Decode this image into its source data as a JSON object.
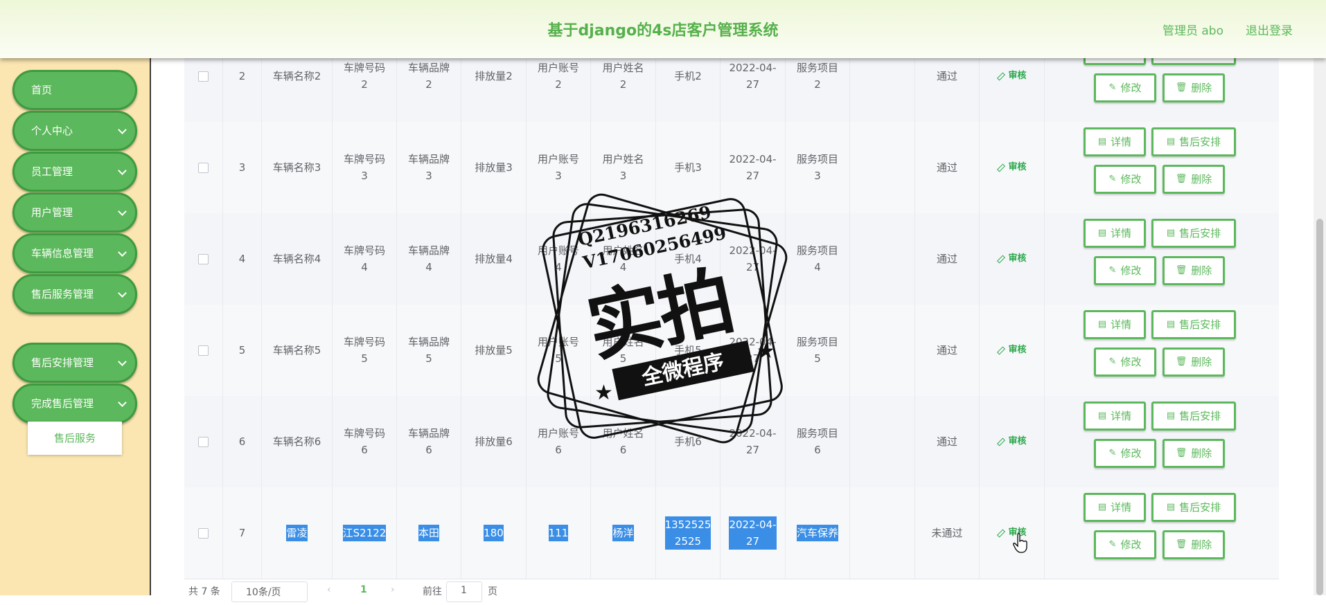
{
  "header": {
    "title": "基于django的4s店客户管理系统",
    "user_label": "管理员 abo",
    "logout_label": "退出登录"
  },
  "sidebar": {
    "items": [
      {
        "label": "首页",
        "has_arrow": false
      },
      {
        "label": "个人中心",
        "has_arrow": true
      },
      {
        "label": "员工管理",
        "has_arrow": true
      },
      {
        "label": "用户管理",
        "has_arrow": true
      },
      {
        "label": "车辆信息管理",
        "has_arrow": true
      },
      {
        "label": "售后服务管理",
        "has_arrow": true
      },
      {
        "label": "售后安排管理",
        "has_arrow": true
      },
      {
        "label": "完成售后管理",
        "has_arrow": true
      }
    ],
    "submenu_label": "售后服务"
  },
  "table": {
    "audit_label": "审核",
    "actions": {
      "detail": "详情",
      "arrange": "售后安排",
      "edit": "修改",
      "delete": "删除"
    },
    "rows": [
      {
        "id": "2",
        "car_name": "车辆名称2",
        "plate": "车牌号码\n2",
        "brand": "车辆品牌\n2",
        "displacement": "排放量2",
        "account": "用户账号\n2",
        "username": "用户姓名\n2",
        "phone": "手机2",
        "date": "2022-04-\n27",
        "service": "服务项目\n2",
        "status": "通过",
        "selected": false,
        "partial": true
      },
      {
        "id": "3",
        "car_name": "车辆名称3",
        "plate": "车牌号码\n3",
        "brand": "车辆品牌\n3",
        "displacement": "排放量3",
        "account": "用户账号\n3",
        "username": "用户姓名\n3",
        "phone": "手机3",
        "date": "2022-04-\n27",
        "service": "服务项目\n3",
        "status": "通过",
        "selected": false,
        "partial": false
      },
      {
        "id": "4",
        "car_name": "车辆名称4",
        "plate": "车牌号码\n4",
        "brand": "车辆品牌\n4",
        "displacement": "排放量4",
        "account": "用户账号\n4",
        "username": "用户姓名\n4",
        "phone": "手机4",
        "date": "2022-04-\n27",
        "service": "服务项目\n4",
        "status": "通过",
        "selected": false,
        "partial": false
      },
      {
        "id": "5",
        "car_name": "车辆名称5",
        "plate": "车牌号码\n5",
        "brand": "车辆品牌\n5",
        "displacement": "排放量5",
        "account": "用户账号\n5",
        "username": "用户姓名\n5",
        "phone": "手机5",
        "date": "2022-04-\n27",
        "service": "服务项目\n5",
        "status": "通过",
        "selected": false,
        "partial": false
      },
      {
        "id": "6",
        "car_name": "车辆名称6",
        "plate": "车牌号码\n6",
        "brand": "车辆品牌\n6",
        "displacement": "排放量6",
        "account": "用户账号\n6",
        "username": "用户姓名\n6",
        "phone": "手机6",
        "date": "2022-04-\n27",
        "service": "服务项目\n6",
        "status": "通过",
        "selected": false,
        "partial": false
      },
      {
        "id": "7",
        "car_name": "雷凌",
        "plate": "江S2122",
        "brand": "本田",
        "displacement": "180",
        "account": "111",
        "username": "杨洋",
        "phone": "1352525\n2525",
        "date": "2022-04-\n27",
        "service": "汽车保养",
        "status": "未通过",
        "selected": true,
        "partial": false
      }
    ]
  },
  "pagination": {
    "total": "共 7 条",
    "page_size": "10条/页",
    "current_page": "1",
    "goto_label": "前往",
    "goto_value": "1",
    "page_suffix": "页"
  },
  "watermark": {
    "code1": "Q2196316269",
    "code2": "V17060256499",
    "big_text": "实拍",
    "ribbon_text": "全微程序"
  },
  "colors": {
    "accent": "#5cb85c",
    "sidebar_bg": "#fbe6b1",
    "selection": "#3a8ee6"
  }
}
